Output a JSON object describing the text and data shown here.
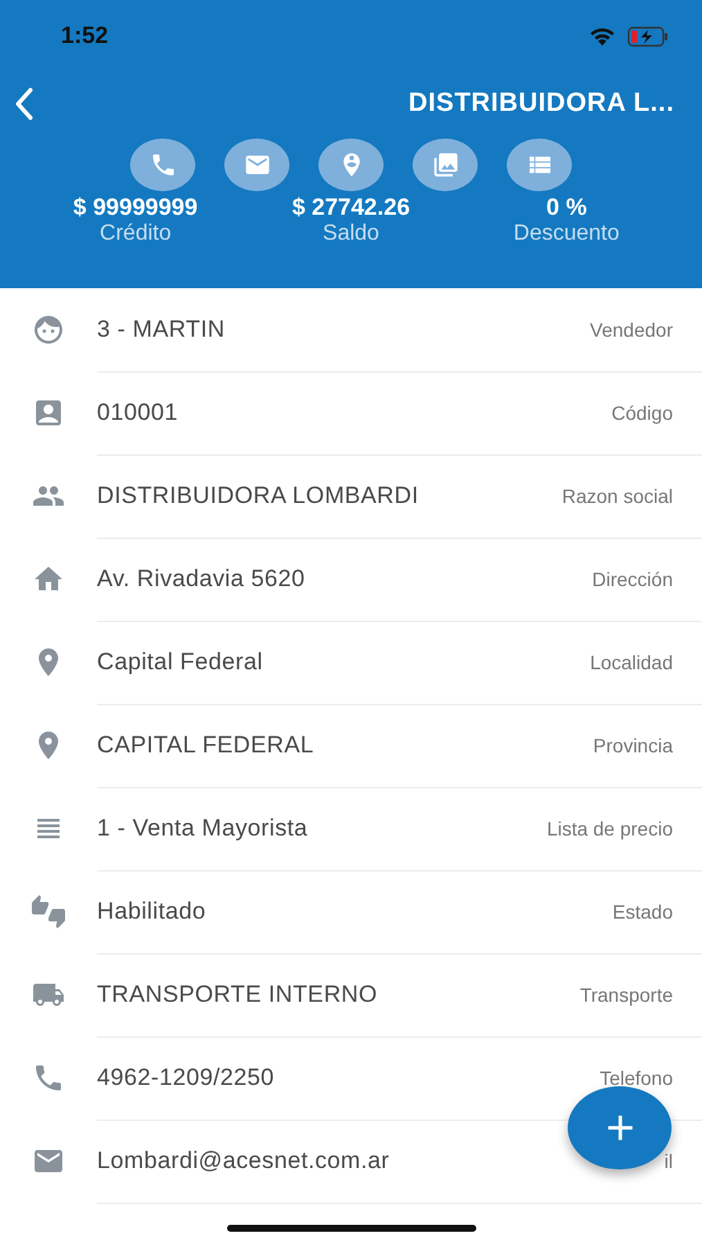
{
  "status_bar": {
    "time": "1:52"
  },
  "header": {
    "title": "DISTRIBUIDORA L..."
  },
  "summary": [
    {
      "value": "$ 99999999",
      "label": "Crédito"
    },
    {
      "value": "$ 27742.26",
      "label": "Saldo"
    },
    {
      "value": "0 %",
      "label": "Descuento"
    }
  ],
  "fields": [
    {
      "value": "3 - MARTIN",
      "label": "Vendedor"
    },
    {
      "value": "010001",
      "label": "Código"
    },
    {
      "value": "DISTRIBUIDORA LOMBARDI",
      "label": "Razon social"
    },
    {
      "value": "Av. Rivadavia 5620",
      "label": "Dirección"
    },
    {
      "value": "Capital Federal",
      "label": "Localidad"
    },
    {
      "value": "CAPITAL FEDERAL",
      "label": "Provincia"
    },
    {
      "value": "1 - Venta Mayorista",
      "label": "Lista de precio"
    },
    {
      "value": "Habilitado",
      "label": "Estado"
    },
    {
      "value": "TRANSPORTE INTERNO",
      "label": "Transporte"
    },
    {
      "value": "4962-1209/2250",
      "label": "Telefono"
    },
    {
      "value": "Lombardi@acesnet.com.ar",
      "label": "il"
    }
  ]
}
